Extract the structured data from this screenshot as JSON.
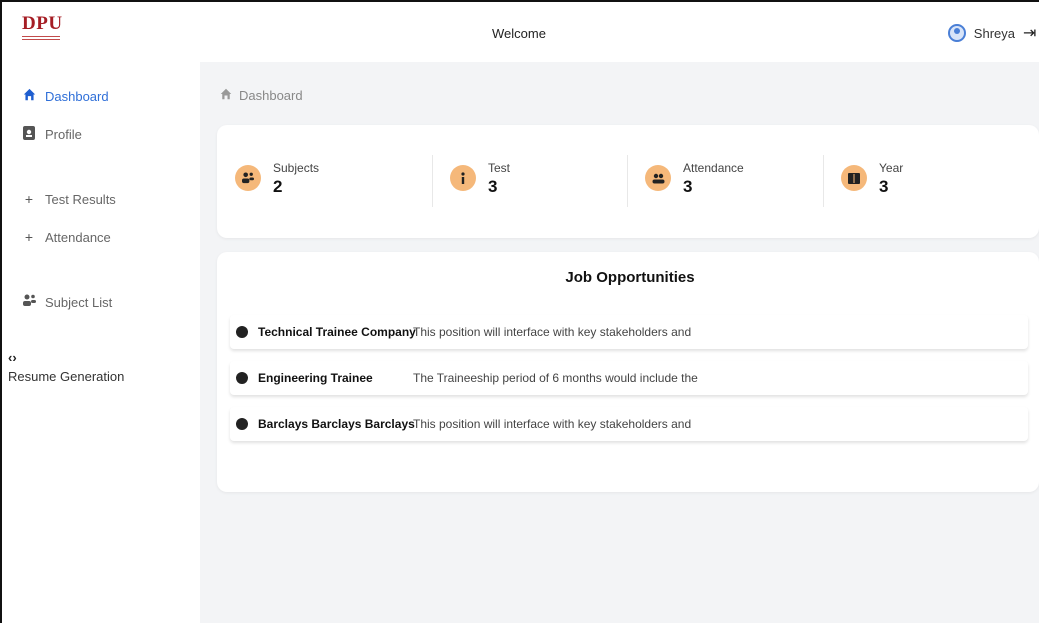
{
  "header": {
    "logo_text": "DPU",
    "title": "Welcome",
    "user_name": "Shreya"
  },
  "sidebar": {
    "items": [
      {
        "label": "Dashboard",
        "icon": "home-icon",
        "active": true
      },
      {
        "label": "Profile",
        "icon": "id-badge-icon",
        "active": false
      },
      {
        "label": "Test Results",
        "icon": "plus-icon",
        "active": false
      },
      {
        "label": "Attendance",
        "icon": "plus-icon",
        "active": false
      },
      {
        "label": "Subject List",
        "icon": "users-icon",
        "active": false
      }
    ],
    "resume": {
      "icon": "code-icon",
      "label": "Resume Generation"
    }
  },
  "breadcrumb": {
    "label": "Dashboard"
  },
  "stats": [
    {
      "label": "Subjects",
      "value": "2",
      "icon": "users-icon"
    },
    {
      "label": "Test",
      "value": "3",
      "icon": "info-icon"
    },
    {
      "label": "Attendance",
      "value": "3",
      "icon": "group-icon"
    },
    {
      "label": "Year",
      "value": "3",
      "icon": "book-icon"
    }
  ],
  "jobs": {
    "title": "Job Opportunities",
    "items": [
      {
        "title": "Technical Trainee Company",
        "description": "This position will interface with key stakeholders and"
      },
      {
        "title": "Engineering Trainee",
        "description": "The Traineeship period of 6 months would include the"
      },
      {
        "title": "Barclays Barclays Barclays",
        "description": "This position will interface with key stakeholders and"
      }
    ]
  },
  "colors": {
    "accent": "#2f6fd8",
    "stat_icon_bg": "#f5b87a",
    "logo": "#a51d24",
    "main_bg": "#f3f4f6"
  }
}
